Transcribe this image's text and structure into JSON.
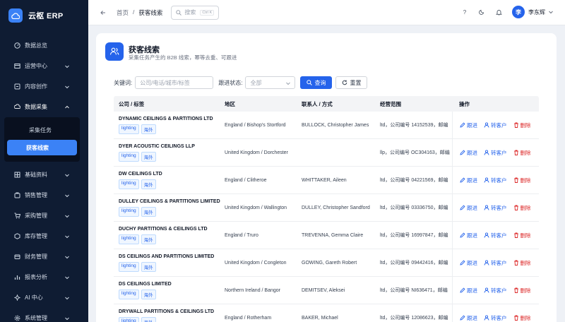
{
  "app": {
    "name": "云枢 ERP"
  },
  "sidebar": {
    "items": [
      {
        "label": "数据总览",
        "icon": "dashboard-icon",
        "expandable": false
      },
      {
        "label": "运营中心",
        "icon": "operations-icon",
        "expandable": true
      },
      {
        "label": "内容创作",
        "icon": "content-icon",
        "expandable": true
      },
      {
        "label": "数据采集",
        "icon": "collection-icon",
        "expandable": true,
        "expanded": true
      }
    ],
    "sub_items": [
      {
        "label": "采集任务",
        "active": false
      },
      {
        "label": "获客线索",
        "active": true
      }
    ],
    "items_after": [
      {
        "label": "基础资料",
        "icon": "base-data-icon"
      },
      {
        "label": "销售管理",
        "icon": "sales-icon"
      },
      {
        "label": "采购管理",
        "icon": "purchase-icon"
      },
      {
        "label": "库存管理",
        "icon": "inventory-icon"
      },
      {
        "label": "财务管理",
        "icon": "finance-icon"
      },
      {
        "label": "报表分析",
        "icon": "report-icon"
      },
      {
        "label": "AI 中心",
        "icon": "ai-icon"
      },
      {
        "label": "系统管理",
        "icon": "system-icon"
      }
    ]
  },
  "topbar": {
    "breadcrumb": [
      "首页",
      "/",
      "获客线索"
    ],
    "search_placeholder": "搜索",
    "search_shortcut": "Ctrl K",
    "help": "?",
    "user_avatar": "李",
    "user_name": "李东辉"
  },
  "page": {
    "title": "获客线索",
    "subtitle": "采集任务产生的 B2B 线索，幂等去重、可跟进"
  },
  "filters": {
    "keyword_label": "关键词:",
    "keyword_placeholder": "公司/电话/城市/标签",
    "status_label": "跟进状态:",
    "status_value": "全部",
    "query_label": "查询",
    "reset_label": "重置"
  },
  "table": {
    "columns": [
      "公司 / 标签",
      "地区",
      "联系人 / 方式",
      "经营范围",
      "操作"
    ],
    "actions": {
      "follow": "跟进",
      "convert": "转客户",
      "delete": "删除"
    },
    "rows": [
      {
        "company": "DYNAMIC CEILINGS & PARTITIONS LTD",
        "tags": [
          "lighting",
          "海外"
        ],
        "region": "England / Bishop's Stortford",
        "contact": "BULLOCK, Christopher James",
        "scope": "ltd，公司编号 14152539，邮编"
      },
      {
        "company": "DYER ACOUSTIC CEILINGS LLP",
        "tags": [
          "lighting",
          "海外"
        ],
        "region": "United Kingdom / Dorchester",
        "contact": "",
        "scope": "llp，公司编号 OC304163，邮编"
      },
      {
        "company": "DW CEILINGS LTD",
        "tags": [
          "lighting",
          "海外"
        ],
        "region": "England / Clitheroe",
        "contact": "WHITTAKER, Aileen",
        "scope": "ltd，公司编号 04221569，邮编"
      },
      {
        "company": "DULLEY CEILINGS & PARTITIONS LIMITED",
        "tags": [
          "lighting",
          "海外"
        ],
        "region": "United Kingdom / Wallington",
        "contact": "DULLEY, Christopher Sandford",
        "scope": "ltd，公司编号 03336750，邮编"
      },
      {
        "company": "DUCHY PARTITIONS & CEILINGS LTD",
        "tags": [
          "lighting",
          "海外"
        ],
        "region": "England / Truro",
        "contact": "TREVENNA, Gemma Claire",
        "scope": "ltd，公司编号 16997847，邮编"
      },
      {
        "company": "DS CEILINGS AND PARTITIONS LIMITED",
        "tags": [
          "lighting",
          "海外"
        ],
        "region": "United Kingdom / Congleton",
        "contact": "GOWING, Gareth Robert",
        "scope": "ltd，公司编号 09442416，邮编"
      },
      {
        "company": "DS CEILINGS LIMITED",
        "tags": [
          "lighting",
          "海外"
        ],
        "region": "Northern Ireland / Bangor",
        "contact": "DEMITSEV, Aleksei",
        "scope": "ltd，公司编号 NI636471，邮编"
      },
      {
        "company": "DRYWALL PARTITIONS & CEILINGS LTD",
        "tags": [
          "lighting",
          "海外"
        ],
        "region": "England / Rotherham",
        "contact": "BAKER, Michael",
        "scope": "ltd，公司编号 12086623，邮编"
      }
    ]
  },
  "colors": {
    "accent": "#2563eb",
    "sidebar_bg": "#0f1c33",
    "danger": "#dc2626"
  }
}
